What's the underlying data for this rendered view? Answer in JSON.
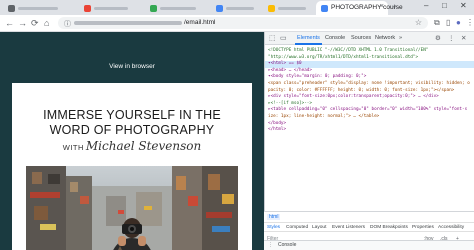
{
  "browser": {
    "active_tab": {
      "title": "PHOTOGRAPHY course",
      "close": "×"
    },
    "new_tab": "+",
    "window": {
      "minimize": "–",
      "maximize": "□",
      "close": "✕"
    },
    "nav": {
      "back": "←",
      "forward": "→",
      "reload": "⟳",
      "home": "⌂"
    },
    "url_tail": "/email.html",
    "bookmark": "☆",
    "toolbar_icons": {
      "extensions": "⧉",
      "split": "▯",
      "profile": "●",
      "menu": "⋮"
    }
  },
  "page": {
    "view_in_browser": "View in browser",
    "headline_line1": "IMMERSE YOURSELF IN THE",
    "headline_line2": "WORD OF PHOTOGRAPHY",
    "byline_with": "WITH",
    "author": "Michael Stevenson"
  },
  "devtools": {
    "tabs": [
      "Elements",
      "Console",
      "Sources",
      "Network"
    ],
    "more": "»",
    "icons": {
      "inspect": "⬚",
      "device": "▭"
    },
    "right": {
      "settings": "⚙",
      "more": "⋮",
      "close": "✕"
    },
    "dom_lines": [
      {
        "t": "<!DOCTYPE html PUBLIC \"-//W3C//DTD XHTML 1.0 Transitional//EN\"",
        "c": "com"
      },
      {
        "t": "\"http://www.w3.org/TR/xhtml1/DTD/xhtml1-transitional.dtd\">",
        "c": "com"
      },
      {
        "t": "▾<html> == $0",
        "c": "tag",
        "selected": true
      },
      {
        "t": "  ▸<head> … </head>",
        "c": "tag"
      },
      {
        "t": "  ▾<body style=\"margin: 0; padding: 0;\">",
        "c": "tag"
      },
      {
        "t": "    <span class=\"preheader\" style=\"display: none !important; visibility: hidden; o",
        "c": "attr"
      },
      {
        "t": "    pacity: 0; color: #FFFFFF; height: 0; width: 0; font-size: 1px;\"></span>",
        "c": "attr"
      },
      {
        "t": "    ▸<div style=\"font-size:0px;color:transparent;opacity:0;\"> … </div>",
        "c": "tag"
      },
      {
        "t": "    ▸<!--[if mso]>-->",
        "c": "com"
      },
      {
        "t": "    ▸<table cellpadding=\"0\" cellspacing=\"0\" border=\"0\" width=\"100%\" style=\"font-s",
        "c": "tag"
      },
      {
        "t": "      ize: 1px; line-height: normal;\"> … </table>",
        "c": "attr"
      },
      {
        "t": "    </body>",
        "c": "tag"
      },
      {
        "t": "  </html>",
        "c": "tag"
      }
    ],
    "crumb": "html",
    "subtabs": [
      "Styles",
      "Computed",
      "Layout",
      "Event Listeners",
      "DOM Breakpoints",
      "Properties",
      "Accessibility"
    ],
    "filter_placeholder": "Filter",
    "filter_right": [
      ":hov",
      ".cls",
      "+"
    ],
    "console_label": "Console",
    "console_icon": "⋮"
  }
}
